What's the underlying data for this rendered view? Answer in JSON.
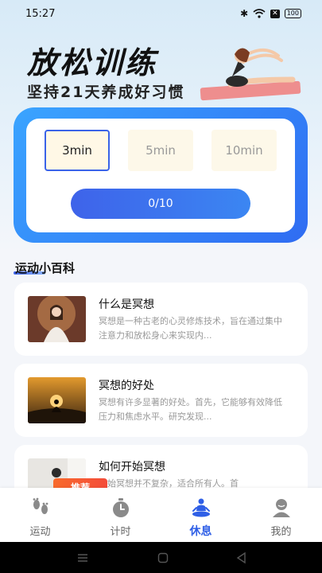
{
  "status": {
    "time": "15:27",
    "battery": "100",
    "sim": "✕"
  },
  "hero": {
    "title": "放松训练",
    "subtitle": "坚持21天养成好习惯"
  },
  "timer": {
    "durations": [
      "3min",
      "5min",
      "10min"
    ],
    "selected_index": 0,
    "progress_label": "0/10",
    "progress": {
      "done": 0,
      "total": 10
    }
  },
  "section": {
    "title": "运动小百科"
  },
  "articles": [
    {
      "title": "什么是冥想",
      "desc": "冥想是一种古老的心灵修炼技术，旨在通过集中注意力和放松身心来实现内..."
    },
    {
      "title": "冥想的好处",
      "desc": "冥想有许多显著的好处。首先，它能够有效降低压力和焦虑水平。研究发现..."
    },
    {
      "title": "如何开始冥想",
      "desc": "开始冥想并不复杂，适合所有人。首"
    }
  ],
  "badge": "推荐",
  "tabs": [
    {
      "label": "运动",
      "icon": "footprints-icon"
    },
    {
      "label": "计时",
      "icon": "stopwatch-icon"
    },
    {
      "label": "休息",
      "icon": "meditation-icon"
    },
    {
      "label": "我的",
      "icon": "profile-icon"
    }
  ],
  "active_tab": 2,
  "colors": {
    "accent": "#2f5fe6",
    "badge": "#f4533a",
    "card_gradient_start": "#3aa4ff",
    "card_gradient_end": "#2f6cf2"
  }
}
